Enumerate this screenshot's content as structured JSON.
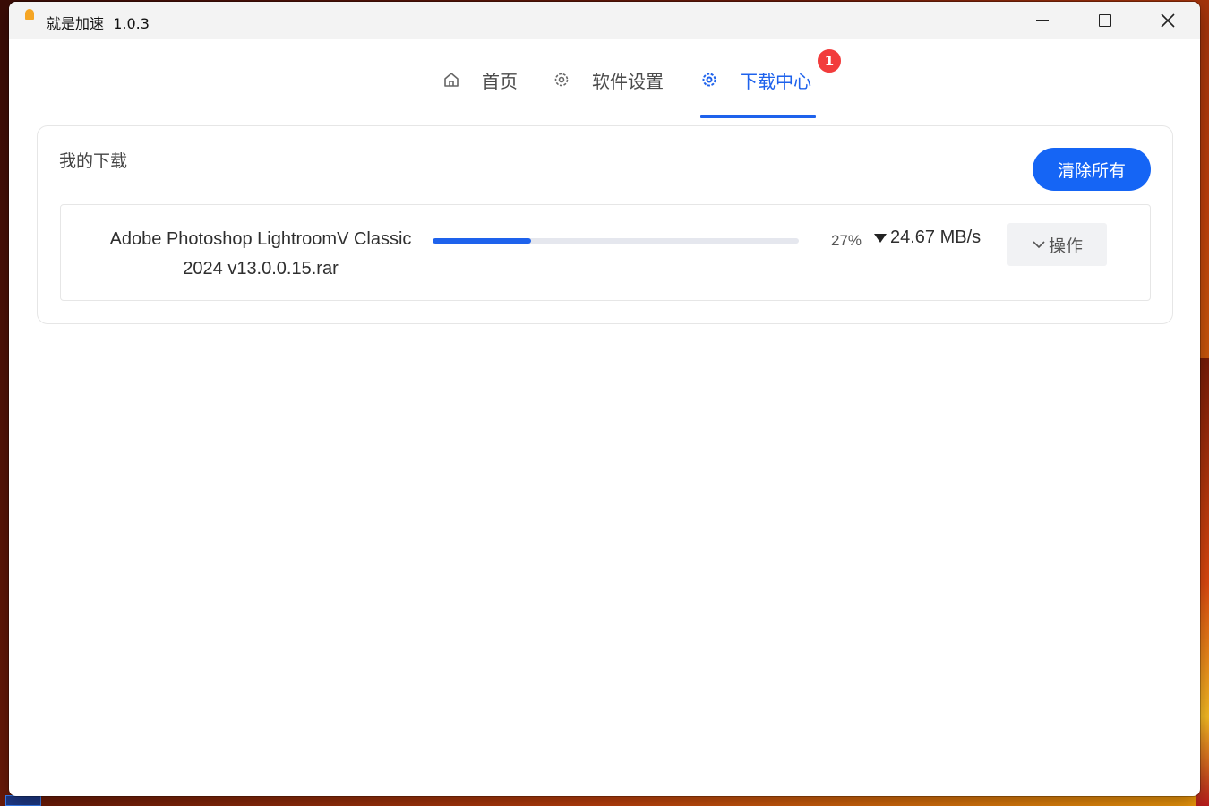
{
  "window": {
    "title": "就是加速",
    "version": "1.0.3"
  },
  "nav": {
    "tabs": [
      {
        "label": "首页",
        "icon": "home-icon",
        "active": false
      },
      {
        "label": "软件设置",
        "icon": "gear-icon",
        "active": false
      },
      {
        "label": "下载中心",
        "icon": "gear-icon",
        "active": true
      }
    ],
    "badge": "1"
  },
  "downloads": {
    "title": "我的下载",
    "clear_label": "清除所有",
    "items": [
      {
        "name_line1": "Adobe Photoshop LightroomV Classic",
        "name_line2": "2024 v13.0.0.15.rar",
        "progress": 27,
        "progress_label": "27%",
        "speed": "24.67 MB/s",
        "action_label": "操作"
      }
    ]
  },
  "colors": {
    "accent": "#1e62ec",
    "button": "#1565f5",
    "badge": "#f23c3c"
  }
}
